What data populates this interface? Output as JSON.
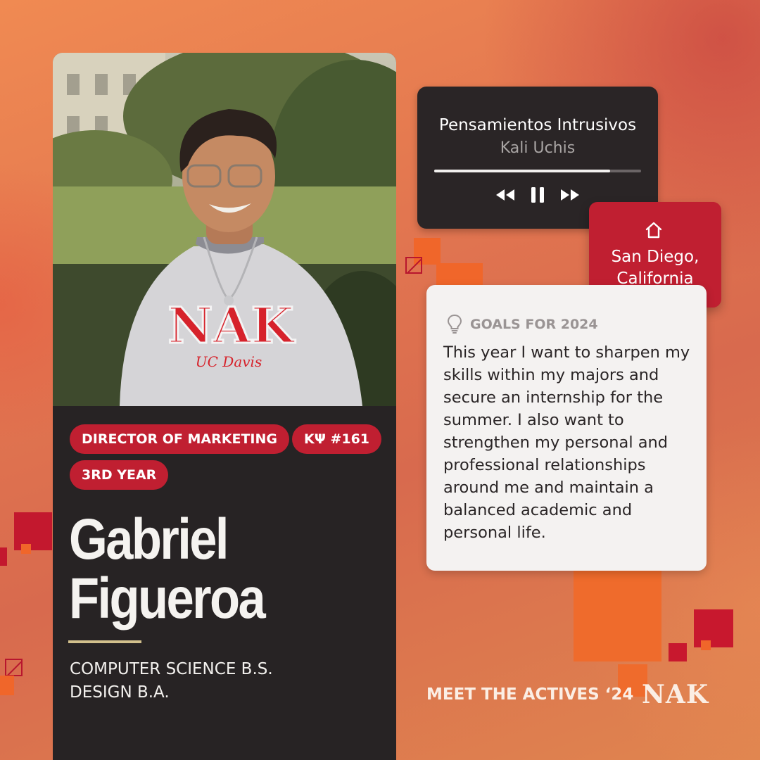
{
  "profile": {
    "tags": [
      "DIRECTOR OF MARKETING",
      "ΚΨ #161",
      "3RD YEAR"
    ],
    "first_name": "Gabriel",
    "last_name": "Figueroa",
    "majors": [
      "COMPUTER SCIENCE B.S.",
      "DESIGN B.A."
    ],
    "sweatshirt_letters": "NAK",
    "sweatshirt_script": "UC Davis"
  },
  "music": {
    "title": "Pensamientos Intrusivos",
    "artist": "Kali Uchis",
    "progress": 0.85,
    "controls": [
      "rewind-icon",
      "pause-icon",
      "fast-forward-icon"
    ]
  },
  "location": {
    "icon": "home-icon",
    "line1": "San Diego,",
    "line2": "California"
  },
  "goals": {
    "icon": "lightbulb-icon",
    "heading": "GOALS FOR 2024",
    "body": "This year I want to sharpen my skills within my majors and secure an internship for the summer. I also want to strengthen my personal and professional relationships around me and maintain a balanced academic and personal life."
  },
  "footer": {
    "caption": "MEET THE ACTIVES ‘24",
    "logo": "NAK"
  },
  "colors": {
    "accent_red": "#c01f31",
    "card_dark": "#272324",
    "card_light": "#f4f2f1",
    "gold_rule": "#d2c08c"
  }
}
